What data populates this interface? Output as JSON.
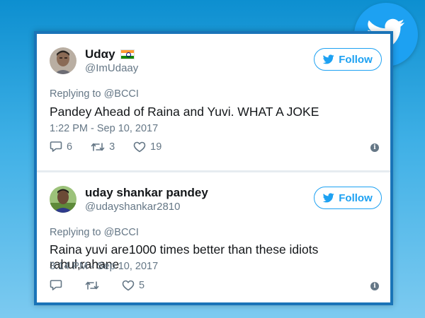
{
  "tweets": [
    {
      "display_name": "Udαy",
      "handle": "@ImUdaay",
      "follow_label": "Follow",
      "replying_to": "Replying to @BCCI",
      "text": "Pandey Ahead of Raina and Yuvi. WHAT A JOKE",
      "timestamp": "1:22 PM - Sep 10, 2017",
      "replies": "6",
      "retweets": "3",
      "likes": "19",
      "has_flag": true
    },
    {
      "display_name": "uday shankar pandey",
      "handle": "@udayshankar2810",
      "follow_label": "Follow",
      "replying_to": "Replying to @BCCI",
      "text": "Raina yuvi are1000 times better than these idiots rahul,rahane",
      "timestamp": "3:14 PM - Sep 10, 2017",
      "replies": "",
      "retweets": "",
      "likes": "5",
      "has_flag": false
    }
  ],
  "icons": {
    "brand": "twitter-bird-icon",
    "reply": "reply-icon",
    "retweet": "retweet-icon",
    "like": "heart-icon",
    "info": "info-icon"
  },
  "colors": {
    "twitter_blue": "#1da1f2",
    "frame_blue": "#1a74b8",
    "muted_text": "#657786"
  }
}
